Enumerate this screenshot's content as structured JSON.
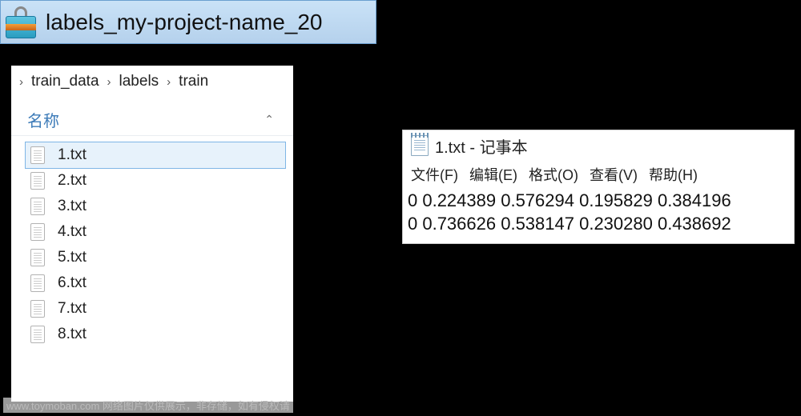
{
  "archive": {
    "title": "labels_my-project-name_20"
  },
  "explorer": {
    "breadcrumb": [
      "train_data",
      "labels",
      "train"
    ],
    "column_header": "名称",
    "files": [
      "1.txt",
      "2.txt",
      "3.txt",
      "4.txt",
      "5.txt",
      "6.txt",
      "7.txt",
      "8.txt"
    ],
    "selected_index": 0
  },
  "notepad": {
    "title": "1.txt - 记事本",
    "menu": [
      "文件(F)",
      "编辑(E)",
      "格式(O)",
      "查看(V)",
      "帮助(H)"
    ],
    "lines": [
      "0 0.224389 0.576294 0.195829 0.384196",
      "0 0.736626 0.538147 0.230280 0.438692"
    ]
  },
  "watermark": "www.toymoban.com 网络图片仅供展示，非存储，如有侵权请"
}
